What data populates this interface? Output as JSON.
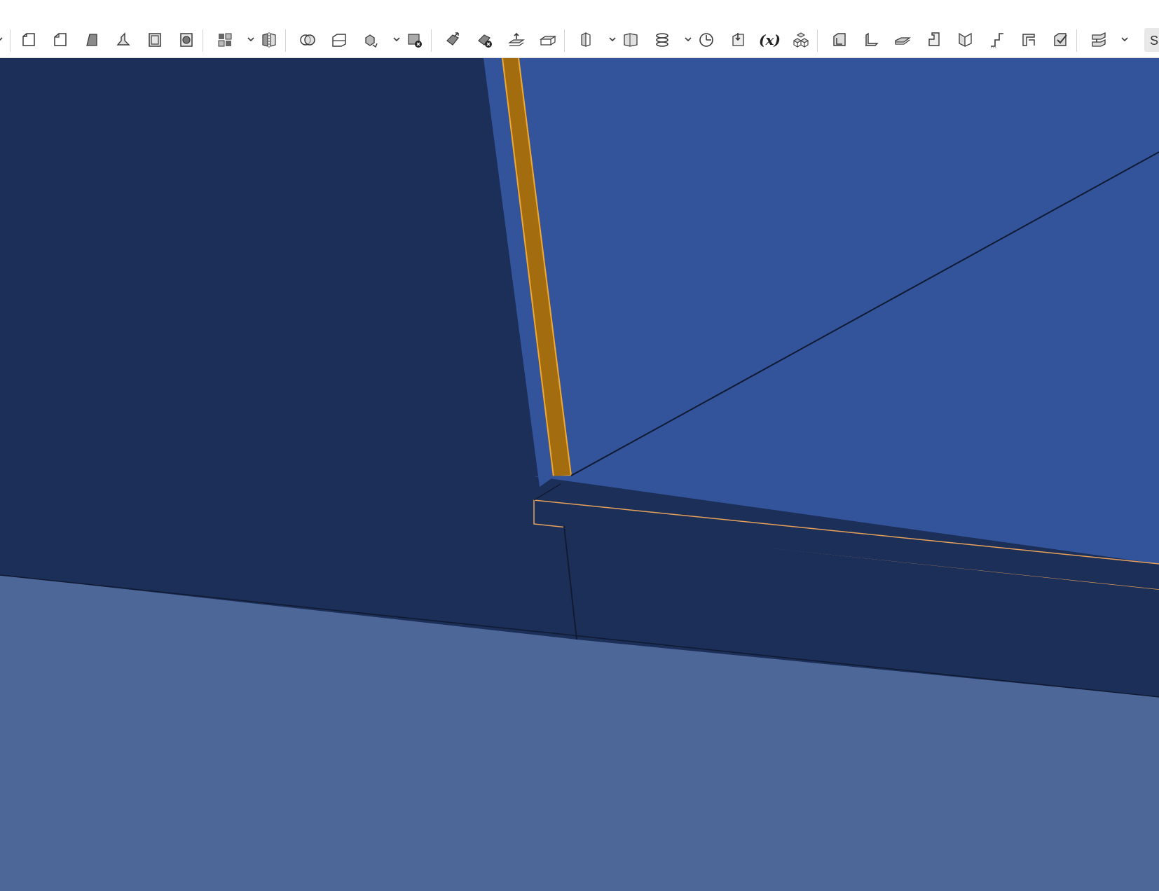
{
  "toolbar": {
    "left_chevron_icon": "chevron-down-icon",
    "groups": [
      {
        "items": [
          "fillet-icon",
          "chamfer-icon",
          "draft-icon",
          "rib-icon",
          "shell-icon",
          "hole-icon"
        ]
      },
      {
        "items": [
          "pattern-icon",
          "pattern-dropdown",
          "mirror-icon"
        ]
      },
      {
        "items": [
          "boolean-icon",
          "split-icon",
          "transform-icon",
          "transform-dropdown",
          "delete-body-icon"
        ]
      },
      {
        "items": [
          "move-face-icon",
          "delete-face-icon",
          "offset-surface-icon",
          "thicken-icon"
        ]
      },
      {
        "items": [
          "loft-icon",
          "loft-dropdown",
          "plane-icon",
          "helix-icon",
          "helix-dropdown",
          "mate-connector-icon",
          "import-icon",
          "variable-icon",
          "derived-icon"
        ]
      },
      {
        "items": [
          "sheet-metal-model-icon",
          "flange-icon",
          "tab-icon",
          "joint-icon",
          "hem-icon",
          "jog-icon",
          "corner-icon",
          "finish-sheet-metal-icon"
        ]
      },
      {
        "items": [
          "frame-icon",
          "frame-dropdown"
        ]
      }
    ],
    "variable_label": "(x)",
    "partial_label": "S"
  },
  "viewport": {
    "colors": {
      "wall_face": "#1c2f58",
      "top_face": "#33549b",
      "floor_face": "#4d6799",
      "edge": "#101a33",
      "selection": "#e8a15c",
      "selected_fill": "#a36d0f",
      "selected_outline": "#f0a830"
    }
  }
}
